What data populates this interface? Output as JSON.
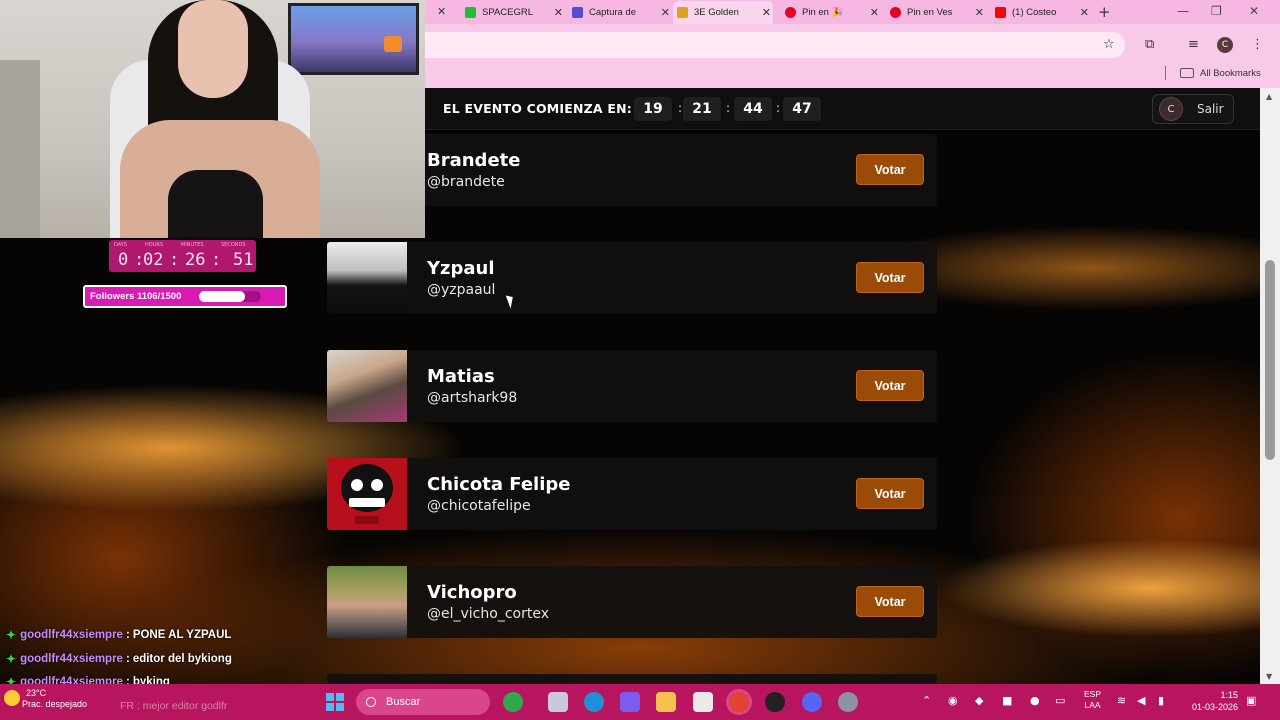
{
  "browser": {
    "tabs": [
      {
        "label": "SPACEGRL",
        "favicon": "green-k-icon",
        "color": "#1fbf3a"
      },
      {
        "label": "Captura de",
        "favicon": "pen-icon",
        "color": "#5a4bd6"
      },
      {
        "label": "3E Golden",
        "favicon": "3e-logo-icon",
        "color": "#e0a21a"
      },
      {
        "label": "Pin en 🎉",
        "favicon": "pinterest-icon",
        "color": "#e60023"
      },
      {
        "label": "Pin en Ves",
        "favicon": "pinterest-icon",
        "color": "#e60023"
      },
      {
        "label": "(1) Costeo",
        "favicon": "youtube-icon",
        "color": "#ff0000"
      }
    ],
    "profile_initial": "C",
    "bookmarks_label": "All Bookmarks"
  },
  "event": {
    "label": "EL EVENTO COMIENZA EN:",
    "countdown": [
      "19",
      "21",
      "44",
      "47"
    ],
    "separator": ":",
    "user_initial": "C",
    "logout_label": "Salir"
  },
  "candidates": [
    {
      "name": "Brandete",
      "handle": "@brandete",
      "vote_label": "Votar"
    },
    {
      "name": "Yzpaul",
      "handle": "@yzpaaul",
      "vote_label": "Votar"
    },
    {
      "name": "Matias",
      "handle": "@artshark98",
      "vote_label": "Votar"
    },
    {
      "name": "Chicota Felipe",
      "handle": "@chicotafelipe",
      "vote_label": "Votar"
    },
    {
      "name": "Vichopro",
      "handle": "@el_vicho_cortex",
      "vote_label": "Votar"
    }
  ],
  "stream_timer": {
    "labels": [
      "DAYS",
      "HOURS",
      "MINUTES",
      "SECONDS"
    ],
    "values": [
      "0",
      "02",
      "26",
      "51"
    ]
  },
  "followers": {
    "label": "Followers 1106/1500",
    "progress": 0.737
  },
  "chat": [
    {
      "user": "goodlfr44xsiempre",
      "message": "PONE AL YZPAUL"
    },
    {
      "user": "goodlfr44xsiempre",
      "message": "editor del bykiong"
    },
    {
      "user": "goodlfr44xsiempre",
      "message": "byking"
    }
  ],
  "taskbar": {
    "weather_temp": "23°C",
    "weather_desc": "Prac. despejado",
    "ghost_chat": "FR : mejor editor godlfr",
    "search_placeholder": "Buscar",
    "lang_line1": "ESP",
    "lang_line2": "LAA",
    "time": "1:15",
    "date": "01-03-2026",
    "accent": "#b8155f"
  }
}
